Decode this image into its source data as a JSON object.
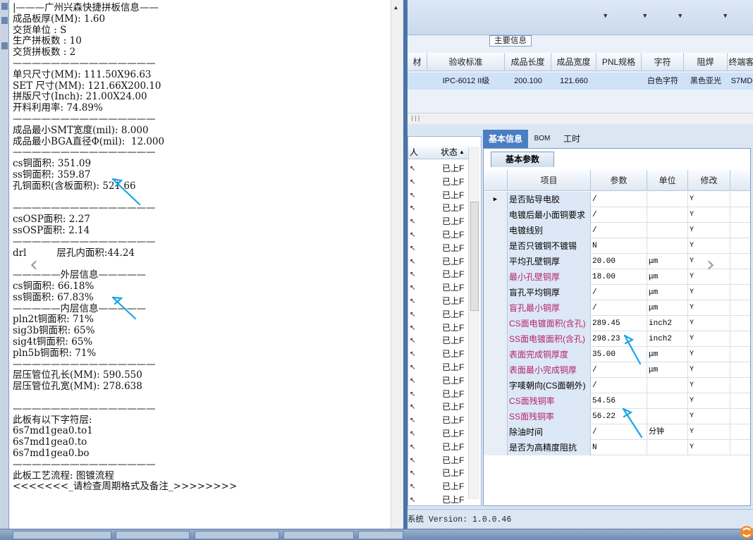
{
  "left_text": [
    "|———广州兴森快捷拼板信息——",
    "成品板厚(MM): 1.60",
    "交货单位 : S",
    "生产拼板数 : 10",
    "交货拼板数 : 2",
    "———————————————",
    "单只尺寸(MM): 111.50X96.63",
    "SET 尺寸(MM): 121.66X200.10",
    "拼版尺寸(Inch): 21.00X24.00",
    "开料利用率: 74.89%",
    "———————————————",
    "成品最小SMT宽度(mil): 8.000",
    "成品最小BGA直径Φ(mil):  12.000",
    "———————————————",
    "cs铜面积: 351.09",
    "ss铜面积: 359.87",
    "孔铜面积(含板面积): 521.66",
    "",
    "———————————————",
    "csOSP面积: 2.27",
    "ssOSP面积: 2.14",
    "———————————————",
    "drl          层孔内面积:44.24",
    "",
    "—————外层信息—————",
    "cs铜面积: 66.18%",
    "ss铜面积: 67.83%",
    "—————内层信息—————",
    "pln2t铜面积: 71%",
    "sig3b铜面积: 65%",
    "sig4t铜面积: 65%",
    "pln5b铜面积: 71%",
    "———————————————",
    "层压管位孔长(MM): 590.550",
    "层压管位孔宽(MM): 278.638",
    "",
    "———————————————",
    "此板有以下字符层:",
    "6s7md1gea0.to1",
    "6s7md1gea0.to",
    "6s7md1gea0.bo",
    "———————————————",
    "此板工艺流程: 图镀流程",
    "<<<<<<<_请检查周期格式及备注_>>>>>>>>"
  ],
  "main_info": {
    "section_label": "主要信息",
    "headers": [
      "材",
      "验收标准",
      "成品长度",
      "成品宽度",
      "PNL规格",
      "字符",
      "阻焊",
      "终端客"
    ],
    "row": [
      "",
      "IPC-6012 II级",
      "200.100",
      "121.660",
      "",
      "白色字符",
      "黑色亚光",
      "S7MD"
    ]
  },
  "list_panel": {
    "headers": [
      "人",
      "状态"
    ],
    "status_value": "已上F",
    "row_count": 26
  },
  "tabs": [
    "基本信息",
    "BOM",
    "工时"
  ],
  "subtab": "基本参数",
  "detail_headers": [
    "项目",
    "参数",
    "单位",
    "修改"
  ],
  "detail_rows": [
    {
      "name": "是否贴导电胶",
      "value": "/",
      "unit": "",
      "mod": "Y",
      "red": false
    },
    {
      "name": "电镀后最小面铜要求",
      "value": "/",
      "unit": "",
      "mod": "Y",
      "red": false
    },
    {
      "name": "电镀线别",
      "value": "/",
      "unit": "",
      "mod": "Y",
      "red": false
    },
    {
      "name": "是否只镀铜不镀锡",
      "value": "N",
      "unit": "",
      "mod": "Y",
      "red": false
    },
    {
      "name": "平均孔壁铜厚",
      "value": "20.00",
      "unit": "μm",
      "mod": "Y",
      "red": false
    },
    {
      "name": "最小孔壁铜厚",
      "value": "18.00",
      "unit": "μm",
      "mod": "Y",
      "red": true
    },
    {
      "name": "盲孔平均铜厚",
      "value": "/",
      "unit": "μm",
      "mod": "Y",
      "red": false
    },
    {
      "name": "盲孔最小铜厚",
      "value": "/",
      "unit": "μm",
      "mod": "Y",
      "red": true
    },
    {
      "name": "CS面电镀面积(含孔)",
      "value": "289.45",
      "unit": "inch2",
      "mod": "Y",
      "red": true
    },
    {
      "name": "SS面电镀面积(含孔)",
      "value": "298.23",
      "unit": "inch2",
      "mod": "Y",
      "red": true
    },
    {
      "name": "表面完成铜厚度",
      "value": "35.00",
      "unit": "μm",
      "mod": "Y",
      "red": true
    },
    {
      "name": "表面最小完成铜厚",
      "value": "/",
      "unit": "μm",
      "mod": "Y",
      "red": true
    },
    {
      "name": "字唛朝向(CS面朝外)",
      "value": "/",
      "unit": "",
      "mod": "Y",
      "red": false
    },
    {
      "name": "CS面残铜率",
      "value": "54.56",
      "unit": "",
      "mod": "Y",
      "red": true
    },
    {
      "name": "SS面残铜率",
      "value": "56.22",
      "unit": "",
      "mod": "Y",
      "red": true
    },
    {
      "name": "除油时间",
      "value": "/",
      "unit": "分钟",
      "mod": "Y",
      "red": false
    },
    {
      "name": "是否为高精度阻抗",
      "value": "N",
      "unit": "",
      "mod": "Y",
      "red": false
    }
  ],
  "status_text": "系统 Version: 1.0.0.46",
  "nav": {
    "prev": "‹",
    "next": "›"
  },
  "colors": {
    "accent": "#4a7ec2",
    "arrow": "#1aa6e0",
    "red_label": "#b4236b"
  }
}
